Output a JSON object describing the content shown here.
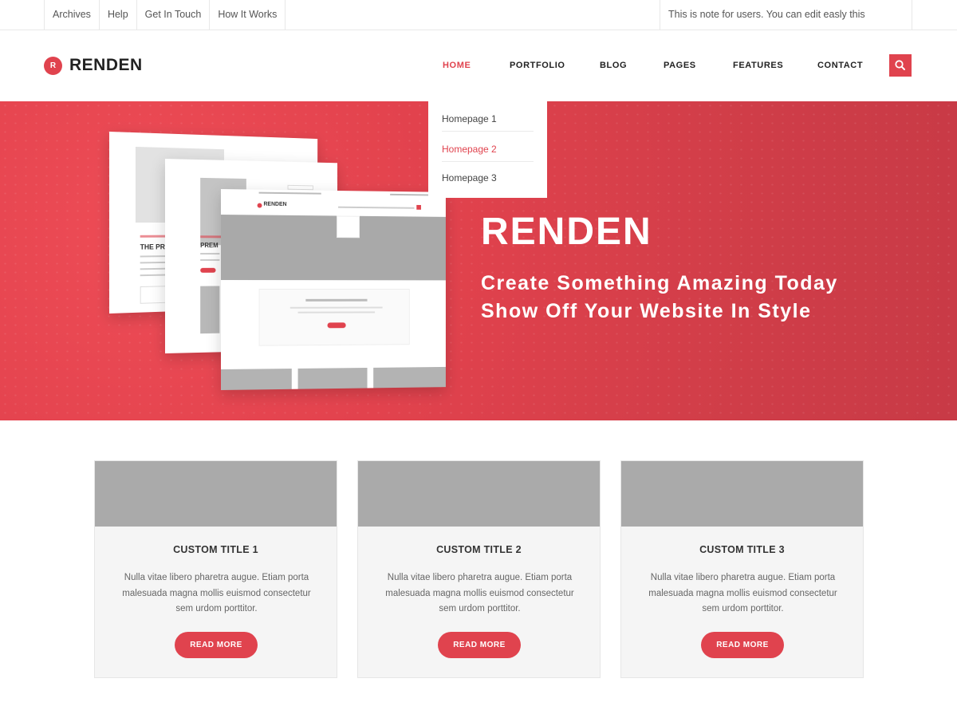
{
  "topbar": {
    "links": [
      "Archives",
      "Help",
      "Get In Touch",
      "How It Works"
    ],
    "note": "This is note for users. You can edit easly this message."
  },
  "header": {
    "logo_letter": "R",
    "logo_text": "RENDEN",
    "nav": [
      "HOME",
      "PORTFOLIO",
      "BLOG",
      "PAGES",
      "FEATURES",
      "CONTACT"
    ],
    "active_nav": "HOME",
    "search_icon": "search-icon"
  },
  "dropdown": {
    "items": [
      "Homepage 1",
      "Homepage 2",
      "Homepage 3"
    ],
    "selected": "Homepage 2"
  },
  "hero": {
    "title": "RENDEN",
    "line1": "Create Something Amazing Today",
    "line2": "Show Off Your Website In Style",
    "mockup": {
      "logo_text": "RENDEN",
      "heading_back": "THE PR",
      "heading_mid": "PREM"
    }
  },
  "cards": [
    {
      "title": "CUSTOM TITLE 1",
      "text": "Nulla vitae libero pharetra augue. Etiam porta malesuada magna mollis euismod consectetur sem urdom porttitor.",
      "button": "READ MORE"
    },
    {
      "title": "CUSTOM TITLE 2",
      "text": "Nulla vitae libero pharetra augue. Etiam porta malesuada magna mollis euismod consectetur sem urdom porttitor.",
      "button": "READ MORE"
    },
    {
      "title": "CUSTOM TITLE 3",
      "text": "Nulla vitae libero pharetra augue. Etiam porta malesuada magna mollis euismod consectetur sem urdom porttitor.",
      "button": "READ MORE"
    }
  ],
  "colors": {
    "accent": "#e0434e",
    "hero_bg": "#d8404b",
    "thumb": "#aaaaaa",
    "card_bg": "#f5f5f5"
  }
}
